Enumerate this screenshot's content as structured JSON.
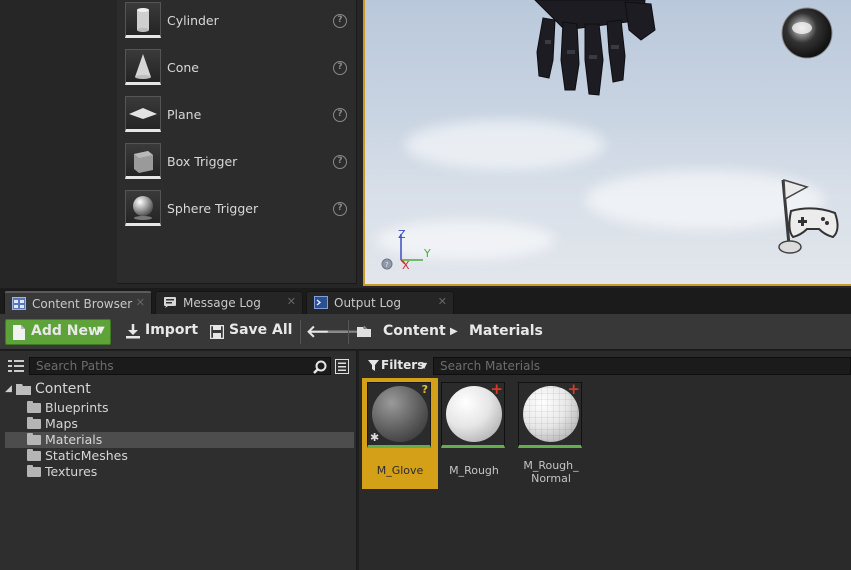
{
  "place_items": [
    {
      "label": "Cylinder",
      "icon": "cylinder-icon"
    },
    {
      "label": "Cone",
      "icon": "cone-icon"
    },
    {
      "label": "Plane",
      "icon": "plane-icon"
    },
    {
      "label": "Box Trigger",
      "icon": "box-trigger-icon"
    },
    {
      "label": "Sphere Trigger",
      "icon": "sphere-trigger-icon"
    }
  ],
  "viewport": {
    "axis_labels": {
      "z": "Z",
      "y": "Y",
      "x": "X"
    }
  },
  "tabs": [
    {
      "label": "Content Browser",
      "icon": "content-browser-icon",
      "active": true
    },
    {
      "label": "Message Log",
      "icon": "message-log-icon",
      "active": false
    },
    {
      "label": "Output Log",
      "icon": "output-log-icon",
      "active": false
    }
  ],
  "toolbar": {
    "add_new_label": "Add New",
    "import_label": "Import",
    "save_all_label": "Save All",
    "breadcrumb": [
      "Content",
      "Materials"
    ]
  },
  "sources": {
    "search_placeholder": "Search Paths",
    "root": "Content",
    "folders": [
      "Blueprints",
      "Maps",
      "Materials",
      "StaticMeshes",
      "Textures"
    ],
    "selected": "Materials"
  },
  "assets": {
    "filters_label": "Filters",
    "search_placeholder": "Search Materials",
    "items": [
      {
        "name": "M_Glove",
        "selected": true,
        "badge": "?"
      },
      {
        "name": "M_Rough",
        "selected": false,
        "badge": "+"
      },
      {
        "name": "M_Rough_ Normal",
        "selected": false,
        "badge": "+"
      }
    ]
  },
  "colors": {
    "accent_green": "#5ea23a",
    "selection_gold": "#d4a017",
    "viewport_border": "#c79a2a"
  }
}
